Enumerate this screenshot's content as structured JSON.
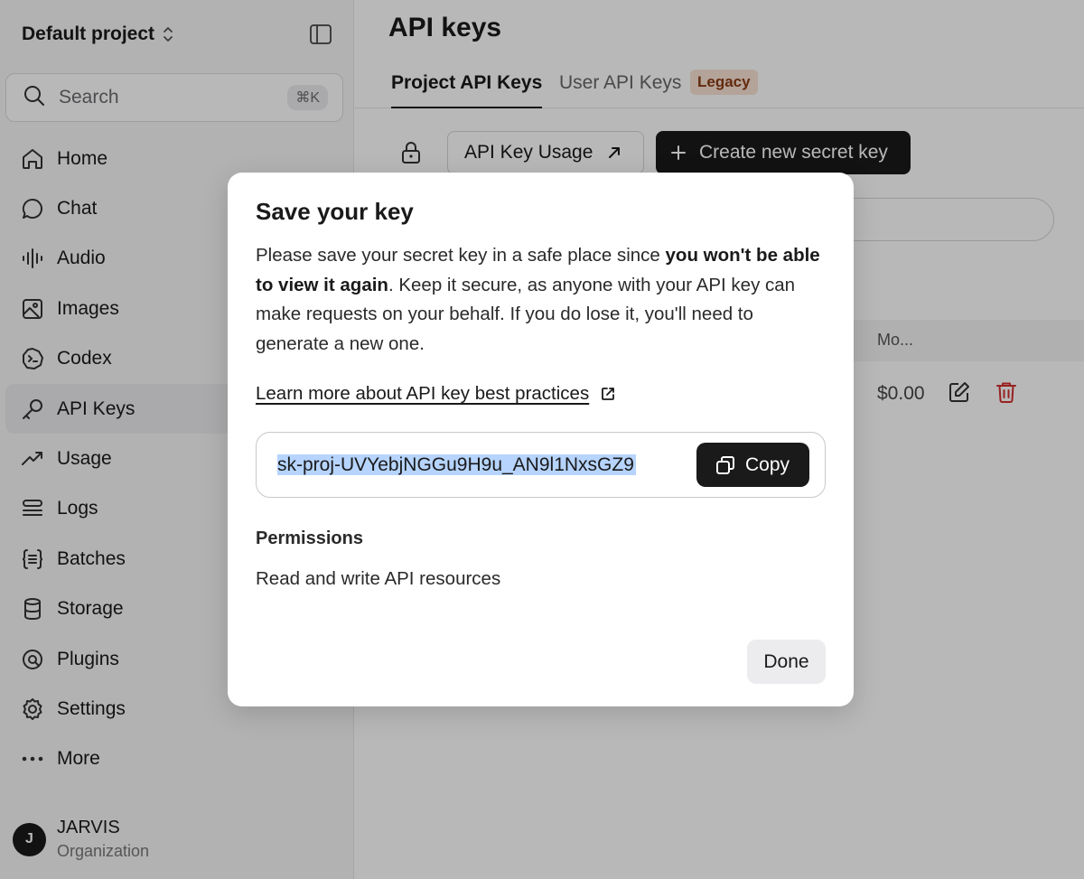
{
  "sidebar": {
    "project_name": "Default project",
    "search": {
      "label": "Search",
      "shortcut": "⌘K"
    },
    "items": [
      {
        "label": "Home",
        "icon": "home-icon"
      },
      {
        "label": "Chat",
        "icon": "chat-icon"
      },
      {
        "label": "Audio",
        "icon": "audio-icon"
      },
      {
        "label": "Images",
        "icon": "image-icon"
      },
      {
        "label": "Codex",
        "icon": "codex-icon"
      },
      {
        "label": "API Keys",
        "icon": "key-icon",
        "active": true
      },
      {
        "label": "Usage",
        "icon": "trend-icon"
      },
      {
        "label": "Logs",
        "icon": "logs-icon"
      },
      {
        "label": "Batches",
        "icon": "batches-icon"
      },
      {
        "label": "Storage",
        "icon": "database-icon"
      },
      {
        "label": "Plugins",
        "icon": "plugin-icon"
      },
      {
        "label": "Settings",
        "icon": "gear-icon"
      },
      {
        "label": "More",
        "icon": "more-icon"
      }
    ],
    "user": {
      "initial": "J",
      "name": "JARVIS",
      "org": "Organization"
    }
  },
  "main": {
    "title": "API keys",
    "tabs": [
      {
        "label": "Project API Keys",
        "active": true
      },
      {
        "label": "User API Keys",
        "active": false
      }
    ],
    "legacy_badge": "Legacy",
    "usage_button": "API Key Usage",
    "create_button": "Create new secret key",
    "table": {
      "column_mo": "Mo...",
      "row_price": "$0.00"
    }
  },
  "modal": {
    "title": "Save your key",
    "desc_part1": "Please save your secret key in a safe place since ",
    "desc_bold": "you won't be able to view it again",
    "desc_part2": ". Keep it secure, as anyone with your API key can make requests on your behalf. If you do lose it, you'll need to generate a new one.",
    "learn_link": "Learn more about API key best practices",
    "key_value": "sk-proj-UVYebjNGGu9H9u_AN9l1NxsGZ9",
    "copy_label": "Copy",
    "permissions_title": "Permissions",
    "permissions_value": "Read and write API resources",
    "done_label": "Done"
  },
  "colors": {
    "accent": "#1a1a1a",
    "selection": "#b6d4fd",
    "danger": "#d32f2f",
    "legacy_bg": "#f8e2d5",
    "legacy_fg": "#8a3b12"
  }
}
